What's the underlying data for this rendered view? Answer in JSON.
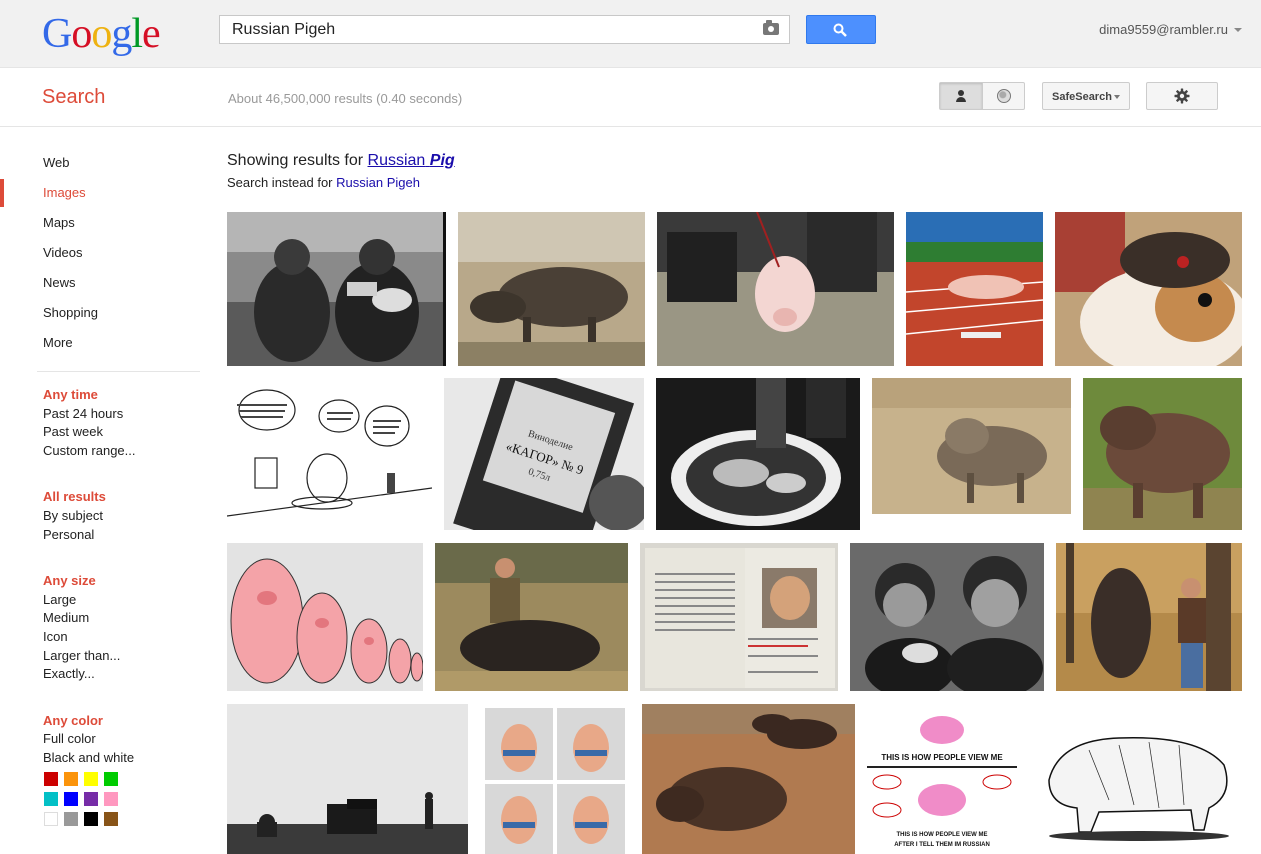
{
  "header": {
    "logo": "Google",
    "query": "Russian Pigeh",
    "user": "dima9559@rambler.ru"
  },
  "subbar": {
    "title": "Search",
    "stats": "About 46,500,000 results (0.40 seconds)",
    "safesearch": "SafeSearch"
  },
  "nav": {
    "items": [
      "Web",
      "Images",
      "Maps",
      "Videos",
      "News",
      "Shopping",
      "More"
    ],
    "active": "Images"
  },
  "tools": {
    "time": {
      "head": "Any time",
      "items": [
        "Past 24 hours",
        "Past week",
        "Custom range..."
      ]
    },
    "results": {
      "head": "All results",
      "items": [
        "By subject",
        "Personal"
      ]
    },
    "size": {
      "head": "Any size",
      "items": [
        "Large",
        "Medium",
        "Icon",
        "Larger than...",
        "Exactly..."
      ]
    },
    "color": {
      "head": "Any color",
      "items": [
        "Full color",
        "Black and white"
      ]
    }
  },
  "swatches": [
    "#cc0000",
    "#fb940b",
    "#ffff00",
    "#00cc00",
    "#03c0c6",
    "#0000ff",
    "#762ca7",
    "#ff98bf",
    "#ffffff",
    "#999999",
    "#000000",
    "#885418"
  ],
  "correction": {
    "prefix": "Showing results for",
    "corrected_plain": "Russian",
    "corrected_emph": "Pig",
    "instead_prefix": "Search instead for",
    "instead_link": "Russian Pigeh"
  },
  "images": [
    {
      "desc": "soldiers-with-pig-bw"
    },
    {
      "desc": "wild-boar-grass"
    },
    {
      "desc": "pig-on-leash"
    },
    {
      "desc": "pig-hurdle-track"
    },
    {
      "desc": "guinea-pig-ushanka"
    },
    {
      "desc": "pig-cartoon-dinner"
    },
    {
      "desc": "kagor-bottle"
    },
    {
      "desc": "hands-in-hatch"
    },
    {
      "desc": "boar-shutterstock"
    },
    {
      "desc": "warthog"
    },
    {
      "desc": "pig-matryoshka"
    },
    {
      "desc": "hunter-with-boar"
    },
    {
      "desc": "passport-pig"
    },
    {
      "desc": "tank-crew-pig"
    },
    {
      "desc": "man-hanging-boar"
    },
    {
      "desc": "field-cannon-bw"
    },
    {
      "desc": "pig-figurines"
    },
    {
      "desc": "boars-dirt"
    },
    {
      "desc": "pig-meme-view"
    },
    {
      "desc": "pig-engraving"
    }
  ],
  "meme_text": {
    "top": "THIS IS HOW PEOPLE VIEW ME",
    "bottom1": "THIS IS HOW PEOPLE VIEW ME",
    "bottom2": "AFTER I TELL THEM IM RUSSIAN"
  },
  "bottle_label": {
    "line1": "Виноделие",
    "line2": "«КАГОР» № 9",
    "line3": "0,75л"
  }
}
